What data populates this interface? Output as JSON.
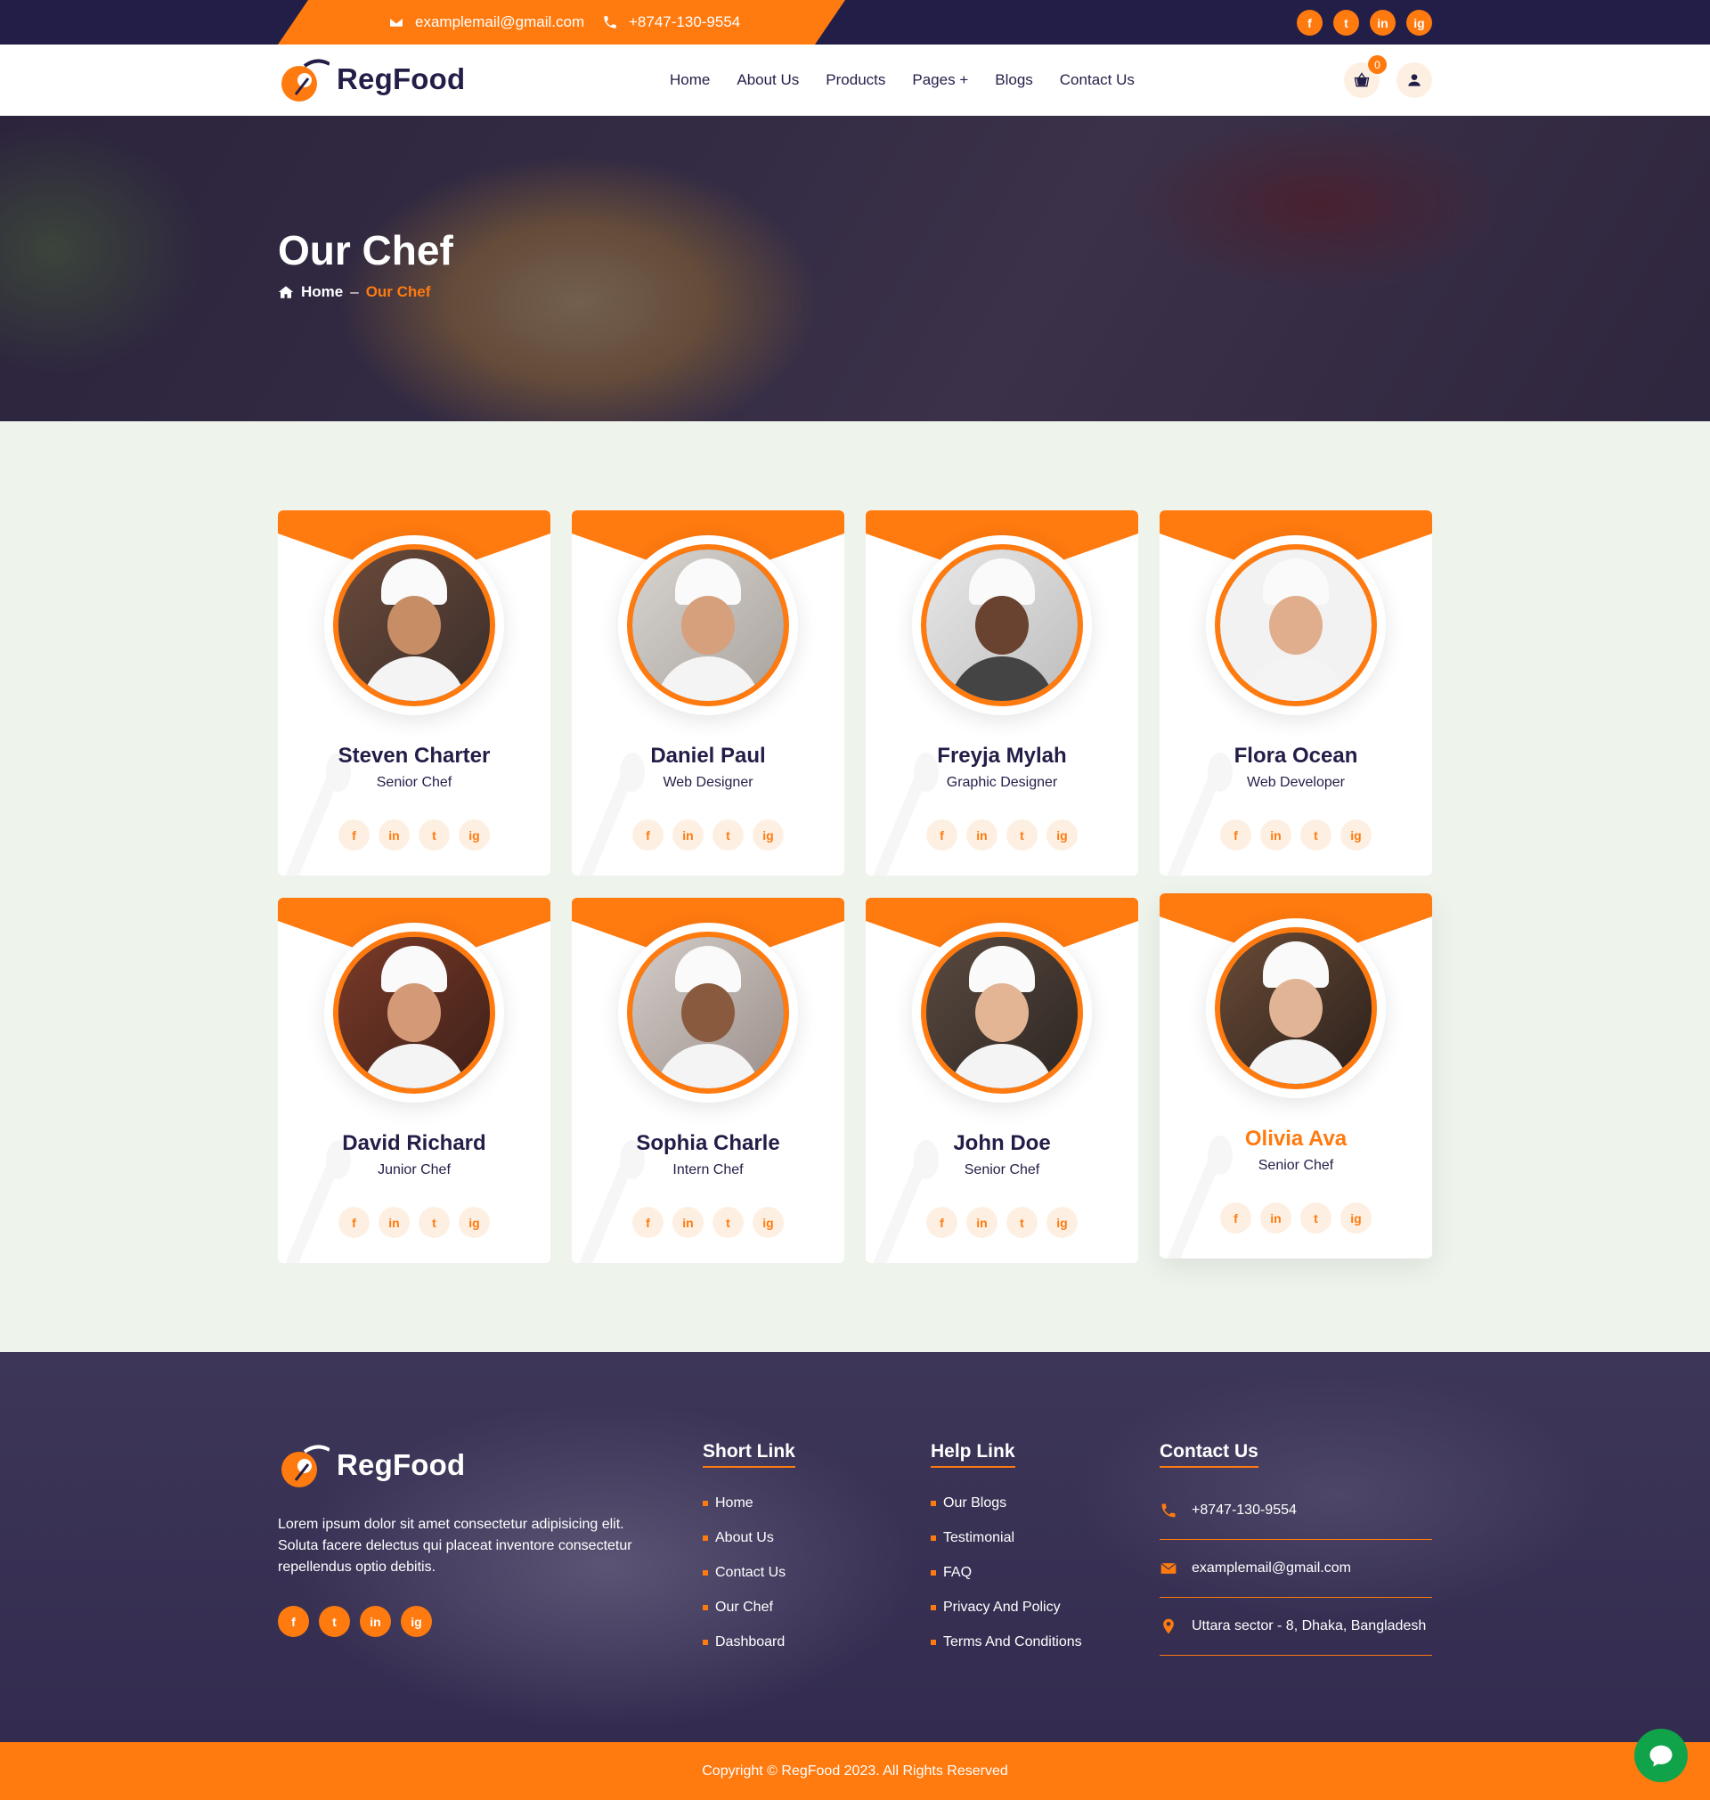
{
  "topbar": {
    "email": "examplemail@gmail.com",
    "phone": "+8747-130-9554",
    "social": [
      "f",
      "t",
      "in",
      "ig"
    ]
  },
  "brand": {
    "name": "RegFood"
  },
  "nav": {
    "items": [
      "Home",
      "About Us",
      "Products",
      "Pages +",
      "Blogs",
      "Contact Us"
    ],
    "cart_count": "0"
  },
  "hero": {
    "title": "Our Chef",
    "crumb_home": "Home",
    "crumb_sep": "–",
    "crumb_current": "Our Chef"
  },
  "chefs": [
    {
      "name": "Steven Charter",
      "role": "Senior Chef"
    },
    {
      "name": "Daniel Paul",
      "role": "Web Designer"
    },
    {
      "name": "Freyja Mylah",
      "role": "Graphic Designer"
    },
    {
      "name": "Flora Ocean",
      "role": "Web Developer"
    },
    {
      "name": "David Richard",
      "role": "Junior Chef"
    },
    {
      "name": "Sophia Charle",
      "role": "Intern Chef"
    },
    {
      "name": "John Doe",
      "role": "Senior Chef"
    },
    {
      "name": "Olivia Ava",
      "role": "Senior Chef"
    }
  ],
  "card_social": [
    "f",
    "in",
    "t",
    "ig"
  ],
  "footer": {
    "description": "Lorem ipsum dolor sit amet consectetur adipisicing elit. Soluta facere delectus qui placeat inventore consectetur repellendus optio debitis.",
    "short_link_title": "Short Link",
    "short_links": [
      "Home",
      "About Us",
      "Contact Us",
      "Our Chef",
      "Dashboard"
    ],
    "help_link_title": "Help Link",
    "help_links": [
      "Our Blogs",
      "Testimonial",
      "FAQ",
      "Privacy And Policy",
      "Terms And Conditions"
    ],
    "contact_title": "Contact Us",
    "contact_phone": "+8747-130-9554",
    "contact_email": "examplemail@gmail.com",
    "contact_address": "Uttara sector - 8, Dhaka, Bangladesh",
    "copyright": "Copyright © RegFood 2023. All Rights Reserved"
  },
  "colors": {
    "accent": "#ff7a0f",
    "dark": "#231e48",
    "page_bg": "#eef4ec",
    "highlight_name": "#ff7a0f",
    "chat": "#10a34a"
  },
  "icons": {
    "email": "envelope-icon",
    "phone": "phone-icon",
    "cart": "basket-icon",
    "user": "user-icon",
    "home": "home-icon",
    "location": "map-pin-icon",
    "chat": "chat-bubble-icon"
  }
}
